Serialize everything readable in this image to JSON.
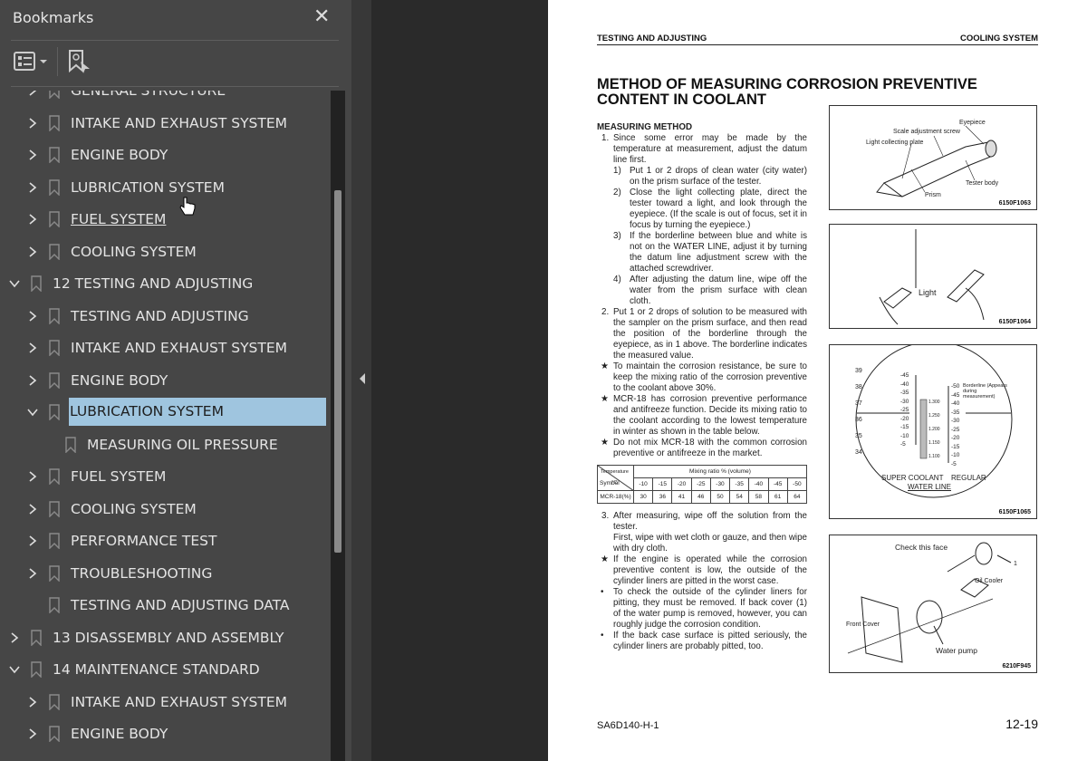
{
  "sidebar": {
    "title": "Bookmarks",
    "items": [
      {
        "label": "GENERAL STRUCTURE",
        "level": 1,
        "expander": "collapsed"
      },
      {
        "label": "INTAKE AND EXHAUST SYSTEM",
        "level": 1,
        "expander": "collapsed"
      },
      {
        "label": "ENGINE BODY",
        "level": 1,
        "expander": "collapsed"
      },
      {
        "label": "LUBRICATION SYSTEM",
        "level": 1,
        "expander": "collapsed",
        "hovered": true
      },
      {
        "label": "FUEL SYSTEM",
        "level": 1,
        "expander": "collapsed",
        "underlined": true
      },
      {
        "label": "COOLING SYSTEM",
        "level": 1,
        "expander": "collapsed"
      },
      {
        "label": "12 TESTING AND ADJUSTING",
        "level": 0,
        "expander": "expanded"
      },
      {
        "label": "TESTING AND ADJUSTING",
        "level": 1,
        "expander": "collapsed"
      },
      {
        "label": "INTAKE AND EXHAUST SYSTEM",
        "level": 1,
        "expander": "collapsed"
      },
      {
        "label": "ENGINE BODY",
        "level": 1,
        "expander": "collapsed"
      },
      {
        "label": "LUBRICATION SYSTEM",
        "level": 1,
        "expander": "expanded",
        "selected": true
      },
      {
        "label": "MEASURING OIL PRESSURE",
        "level": 2,
        "expander": "none"
      },
      {
        "label": "FUEL SYSTEM",
        "level": 1,
        "expander": "collapsed"
      },
      {
        "label": "COOLING SYSTEM",
        "level": 1,
        "expander": "collapsed"
      },
      {
        "label": "PERFORMANCE TEST",
        "level": 1,
        "expander": "collapsed"
      },
      {
        "label": "TROUBLESHOOTING",
        "level": 1,
        "expander": "collapsed"
      },
      {
        "label": "TESTING AND ADJUSTING DATA",
        "level": 1,
        "expander": "none"
      },
      {
        "label": "13 DISASSEMBLY AND ASSEMBLY",
        "level": 0,
        "expander": "collapsed"
      },
      {
        "label": "14 MAINTENANCE STANDARD",
        "level": 0,
        "expander": "expanded"
      },
      {
        "label": "INTAKE AND EXHAUST SYSTEM",
        "level": 1,
        "expander": "collapsed"
      },
      {
        "label": "ENGINE BODY",
        "level": 1,
        "expander": "collapsed"
      }
    ],
    "selected_color": "#9fc5df"
  },
  "page": {
    "header_left": "TESTING AND ADJUSTING",
    "header_right": "COOLING SYSTEM",
    "title": "METHOD OF MEASURING CORROSION PREVENTIVE CONTENT IN COOLANT",
    "section": "MEASURING METHOD",
    "items": [
      {
        "n": "1.",
        "cls": "l1",
        "t": "Since some error may be made by the temperature at measurement, adjust the datum line first."
      },
      {
        "n": "1)",
        "cls": "l2",
        "t": "Put 1 or 2 drops of clean water (city water) on the prism surface of the tester."
      },
      {
        "n": "2)",
        "cls": "l2",
        "t": "Close the light collecting plate, direct the tester toward a light, and look through the eyepiece. (If the scale is out of focus, set it in focus by turning the eyepiece.)"
      },
      {
        "n": "3)",
        "cls": "l2",
        "t": "If the borderline between blue and white is not on the WATER LINE, adjust it by turning the datum line adjustment screw with the attached screwdriver."
      },
      {
        "n": "4)",
        "cls": "l2",
        "t": "After adjusting the datum line, wipe off the water from the prism surface with clean cloth."
      },
      {
        "n": "2.",
        "cls": "l1",
        "t": "Put 1 or 2 drops of solution to be measured with the sampler on the prism surface, and then read the position of the borderline through the eyepiece, as in 1 above. The borderline indicates the measured value."
      },
      {
        "n": "★",
        "cls": "st",
        "t": "To maintain the corrosion resistance, be sure to keep the mixing ratio of the corrosion preventive to the coolant above 30%."
      },
      {
        "n": "★",
        "cls": "st",
        "t": "MCR-18 has corrosion preventive performance and antifreeze function. Decide its mixing ratio to the coolant according to the lowest temperature in winter as shown in the table below."
      },
      {
        "n": "★",
        "cls": "st",
        "t": "Do not mix MCR-18 with the common corrosion preventive or antifreeze in the market."
      }
    ],
    "table": {
      "corner_top": "Temperature °C",
      "corner_bottom": "Symbol",
      "header": "Mixing ratio % (volume)",
      "temps": [
        "-10",
        "-15",
        "-20",
        "-25",
        "-30",
        "-35",
        "-40",
        "-45",
        "-50"
      ],
      "row_label": "MCR-18(%)",
      "values": [
        "30",
        "36",
        "41",
        "46",
        "50",
        "54",
        "58",
        "61",
        "64"
      ]
    },
    "items2": [
      {
        "n": "3.",
        "cls": "l1",
        "t": "After measuring, wipe off the solution from the tester."
      },
      {
        "n": "",
        "cls": "l1",
        "t": "First, wipe with wet cloth or gauze, and then wipe with dry cloth."
      },
      {
        "n": "★",
        "cls": "st",
        "t": "If the engine is operated while the corrosion preventive content is low, the outside of the cylinder liners are pitted in the worst case."
      },
      {
        "n": "•",
        "cls": "st",
        "t": "To check the outside of the cylinder liners for pitting, they must be removed. If back cover (1) of the water pump is removed, however, you can roughly judge the corrosion condition."
      },
      {
        "n": "•",
        "cls": "st",
        "t": "If the back case surface is pitted seriously, the cylinder liners are probably pitted, too."
      }
    ],
    "figures": {
      "fig1": {
        "code": "6150F1063",
        "eyepiece": "Eyepiece",
        "scale_screw": "Scale adjustment screw",
        "light_plate": "Light collecting plate",
        "tester_body": "Tester body",
        "prism": "Prism"
      },
      "fig2": {
        "code": "6150F1064",
        "light": "Light"
      },
      "fig3": {
        "code": "6150F1065",
        "borderline": "Borderline (Appears during measurement)",
        "super_coolant": "SUPER COOLANT",
        "regular": "REGULAR",
        "water_line": "WATER LINE",
        "left_scale": [
          "39",
          "38",
          "37",
          "36",
          "35",
          "34"
        ],
        "mid_scale": [
          "-45",
          "-40",
          "-35",
          "-30",
          "-25",
          "-20",
          "-15",
          "-10",
          "-5"
        ],
        "gravity": [
          "1.300",
          "1.250",
          "1.200",
          "1.150",
          "1.100"
        ],
        "right_scale": [
          "-50",
          "-45",
          "-40",
          "-35",
          "-30",
          "-25",
          "-20",
          "-15",
          "-10",
          "-5"
        ],
        "unit": "°C"
      },
      "fig4": {
        "code": "6210F945",
        "check_face": "Check this face",
        "one": "1",
        "oil_cooler": "Oil Cooler",
        "front_cover": "Front Cover",
        "water_pump": "Water pump"
      }
    },
    "footer_left": "SA6D140-H-1",
    "footer_right": "12-19"
  }
}
